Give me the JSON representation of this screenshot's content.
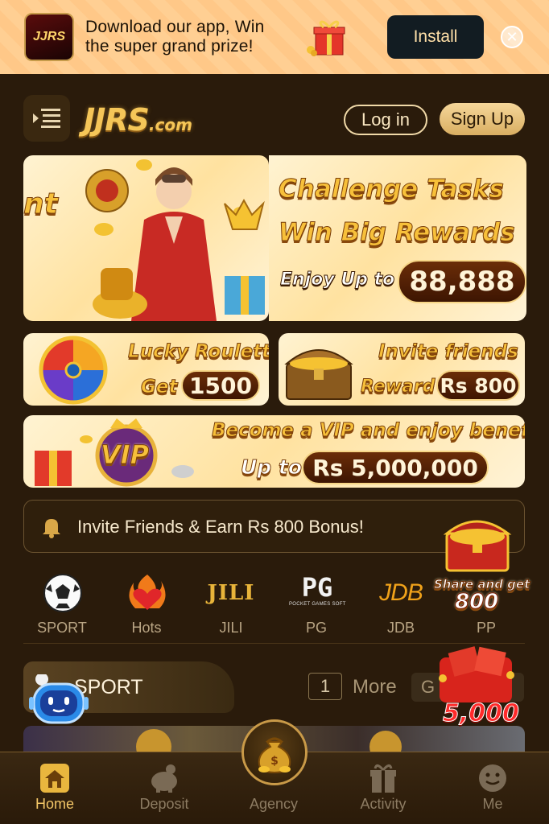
{
  "download_banner": {
    "app_logo_text": "JJRS",
    "line1": "Download our app, Win",
    "line2": "the super grand prize!",
    "install_label": "Install",
    "close_icon": "close-icon"
  },
  "header": {
    "menu_icon": "menu-icon",
    "brand": "JJRS",
    "brand_suffix": ".com",
    "login_label": "Log in",
    "signup_label": "Sign Up"
  },
  "promos": {
    "hero_cut_text": "nt",
    "hero_line1": "Challenge Tasks",
    "hero_line2": "Win Big Rewards",
    "hero_enjoy": "Enjoy Up to",
    "hero_amount": "88,888",
    "roulette_title": "Lucky Roulette",
    "roulette_get": "Get",
    "roulette_amount": "1500",
    "invite_title": "Invite friends",
    "invite_reward": "Reward",
    "invite_amount": "Rs 800",
    "vip_title": "Become a VIP and enjoy benefits",
    "vip_upto": "Up to",
    "vip_amount": "Rs 5,000,000",
    "vip_badge": "VIP"
  },
  "notice": {
    "text": "Invite Friends & Earn Rs 800 Bonus!"
  },
  "categories": [
    {
      "label": "SPORT",
      "icon": "soccer-ball-icon"
    },
    {
      "label": "Hots",
      "icon": "flame-heart-icon"
    },
    {
      "label": "JILI",
      "icon": "jili-logo",
      "logo_text": "JILI"
    },
    {
      "label": "PG",
      "icon": "pg-logo",
      "logo_text": "PG",
      "logo_sub": "POCKET GAMES SOFT"
    },
    {
      "label": "JDB",
      "icon": "jdb-logo",
      "logo_text": "JDB"
    },
    {
      "label": "PP",
      "icon": "pp-logo"
    }
  ],
  "section": {
    "title": "SPORT",
    "page": "1",
    "more_label": "More",
    "g_label": "G"
  },
  "floating": {
    "share_text": "Share and get",
    "share_amount": "800",
    "redbag_amount": "5,000"
  },
  "bottom_nav": [
    {
      "label": "Home",
      "icon": "home-icon",
      "active": true
    },
    {
      "label": "Deposit",
      "icon": "piggy-bank-icon",
      "active": false
    },
    {
      "label": "Agency",
      "icon": "money-bag-icon",
      "active": false
    },
    {
      "label": "Activity",
      "icon": "gift-icon",
      "active": false
    },
    {
      "label": "Me",
      "icon": "smiley-icon",
      "active": false
    }
  ],
  "colors": {
    "background": "#2a1b0b",
    "accent_gold": "#f4c768",
    "banner_bg": "#ffcf93",
    "install_bg": "#121c22"
  }
}
